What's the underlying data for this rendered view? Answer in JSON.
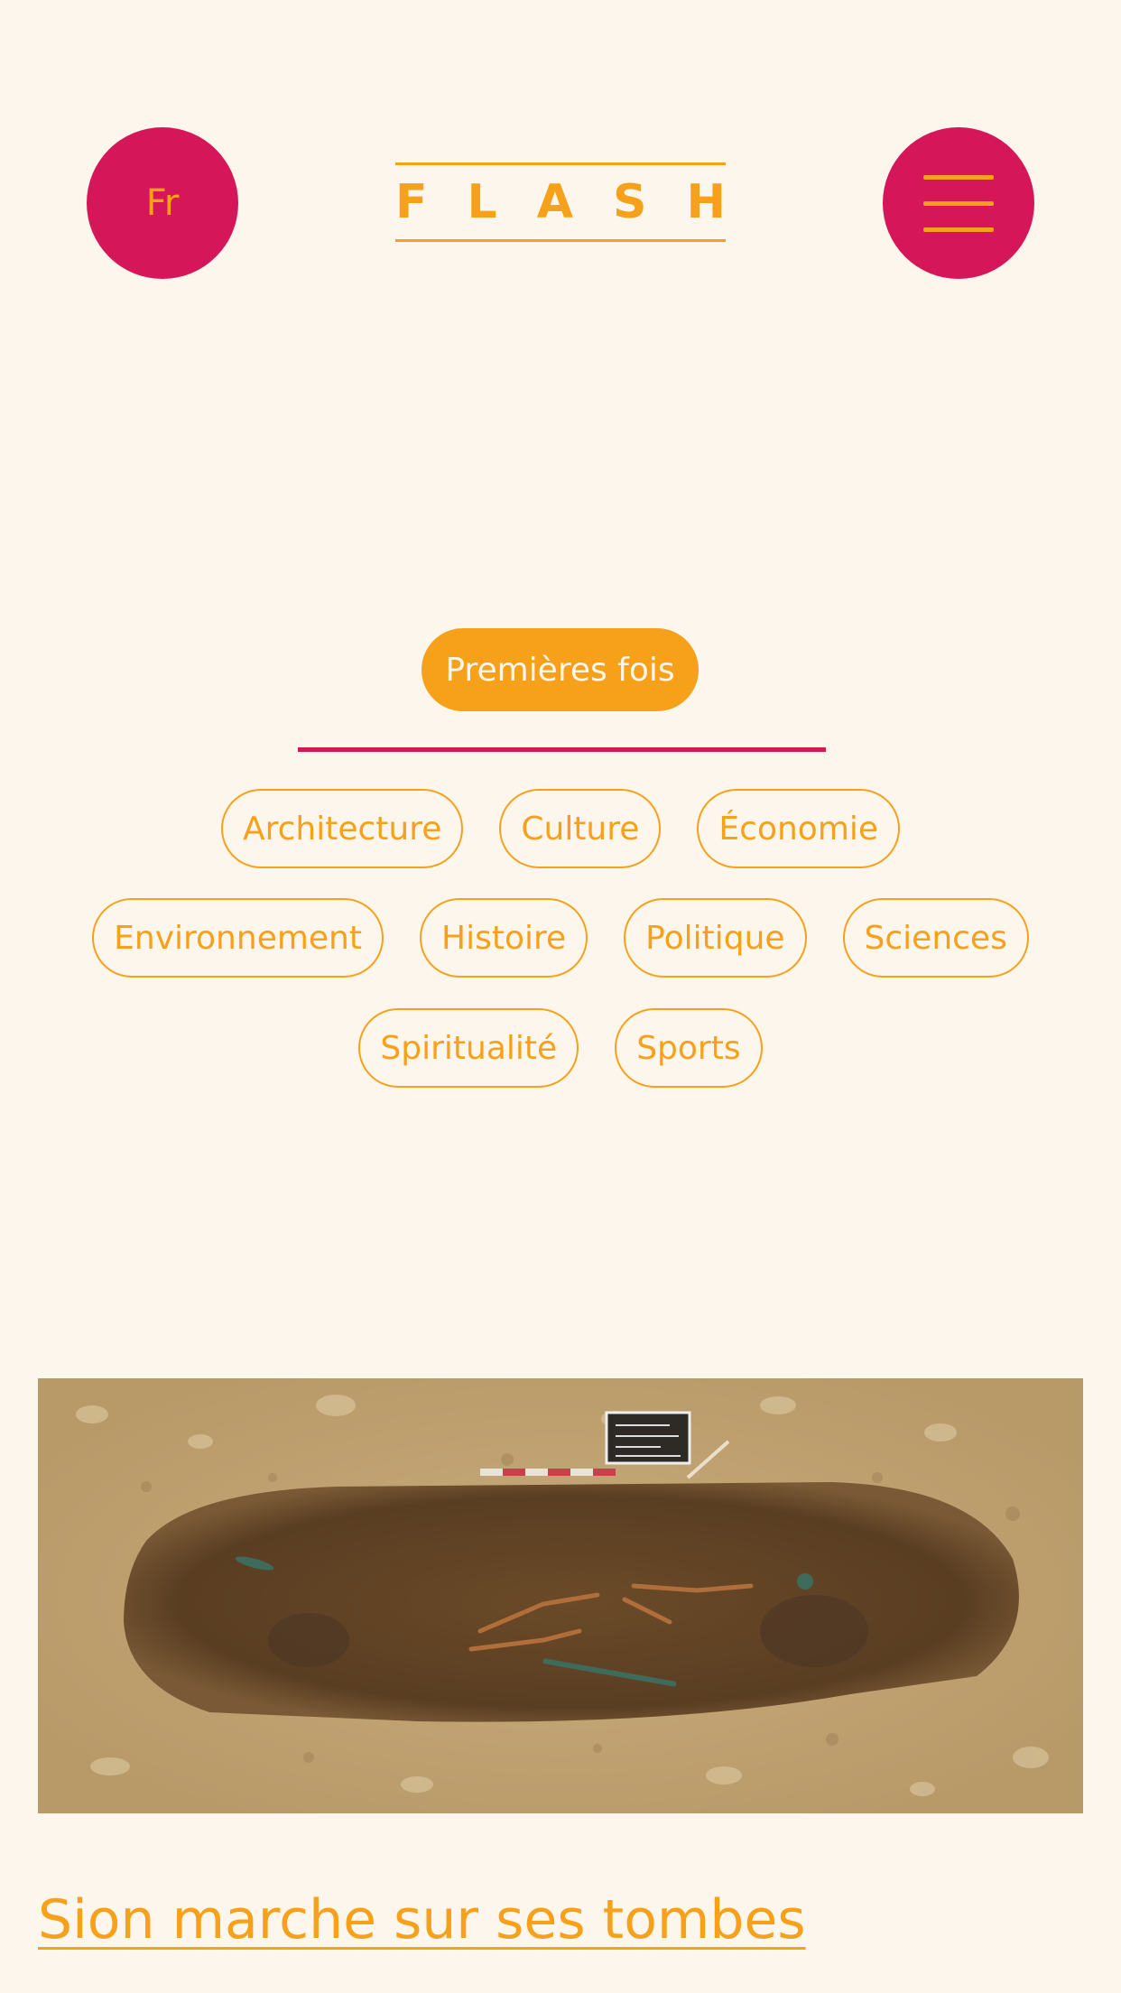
{
  "header": {
    "language_label": "Fr",
    "logo_text": [
      "F",
      "L",
      "A",
      "S",
      "H"
    ]
  },
  "filters": {
    "active": "Premières fois",
    "row1": [
      "Architecture",
      "Culture",
      "Économie"
    ],
    "row2": [
      "Environnement",
      "Histoire",
      "Politique",
      "Sciences"
    ],
    "row3": [
      "Spiritualité",
      "Sports"
    ]
  },
  "article": {
    "image_label": "archaeological-grave-photo",
    "title": "Sion marche sur ses tombes"
  },
  "colors": {
    "background": "#fdf6ec",
    "accent_orange": "#f7a11a",
    "accent_pink": "#d5175a"
  }
}
